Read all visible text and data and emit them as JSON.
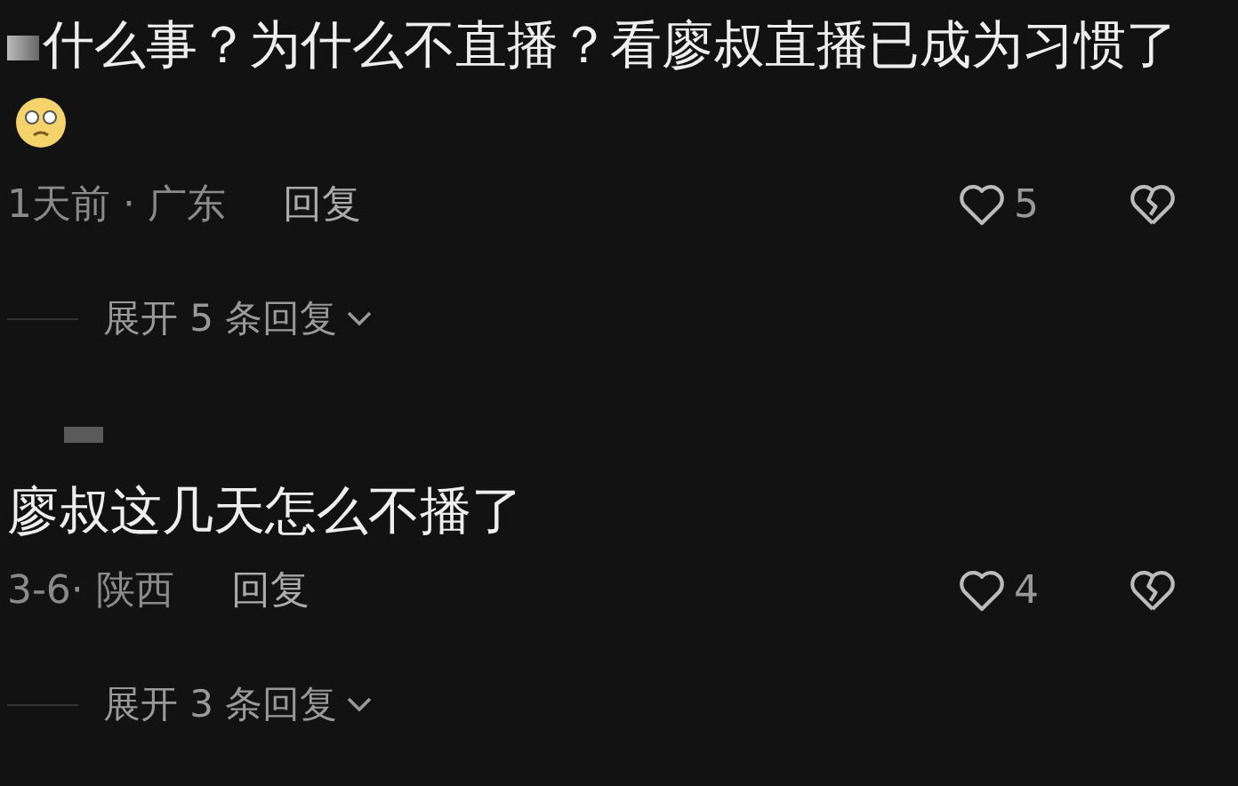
{
  "comments": [
    {
      "text": "什么事？为什么不直播？看廖叔直播已成为习惯了",
      "redacted_start": true,
      "emoji": true,
      "redacted_name": false,
      "date": "1天前 · 广东",
      "reply": "回复",
      "likes": "5",
      "expand": "展开 5 条回复"
    },
    {
      "text": "廖叔这几天怎么不播了",
      "redacted_start": false,
      "emoji": false,
      "redacted_name": true,
      "date": "3-6· 陕西",
      "reply": "回复",
      "likes": "4",
      "expand": "展开 3 条回复"
    }
  ]
}
